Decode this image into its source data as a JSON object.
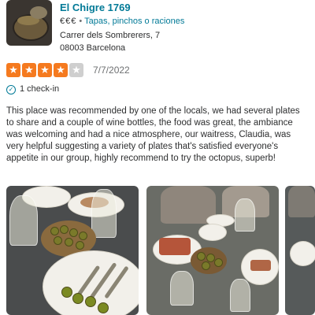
{
  "business": {
    "name": "El Chigre 1769",
    "price": "€€€",
    "separator": " • ",
    "categories": "Tapas, pinchos o raciones",
    "address_line1": "Carrer dels Sombrerers, 7",
    "address_line2": "08003 Barcelona"
  },
  "review": {
    "rating": 4,
    "max_rating": 5,
    "date": "7/7/2022",
    "checkins": "1 check-in",
    "text_lines": [
      "This place was recommended by one of the locals, we had several plates",
      "to share and a couple of wine bottles, the food was great, the ambiance",
      "was welcoming and had a nice atmosphere, our waitress, Claudia, was",
      "very helpful suggesting a variety of plates that's satisfied everyone's",
      "appetite in our group, highly recommend to try the octopus, superb!"
    ]
  },
  "colors": {
    "star_active": "#f57a1f",
    "star_inactive": "#cfcfcf",
    "link": "#027a97"
  },
  "icons": {
    "star": "star-icon",
    "checkin": "check-in-icon"
  }
}
